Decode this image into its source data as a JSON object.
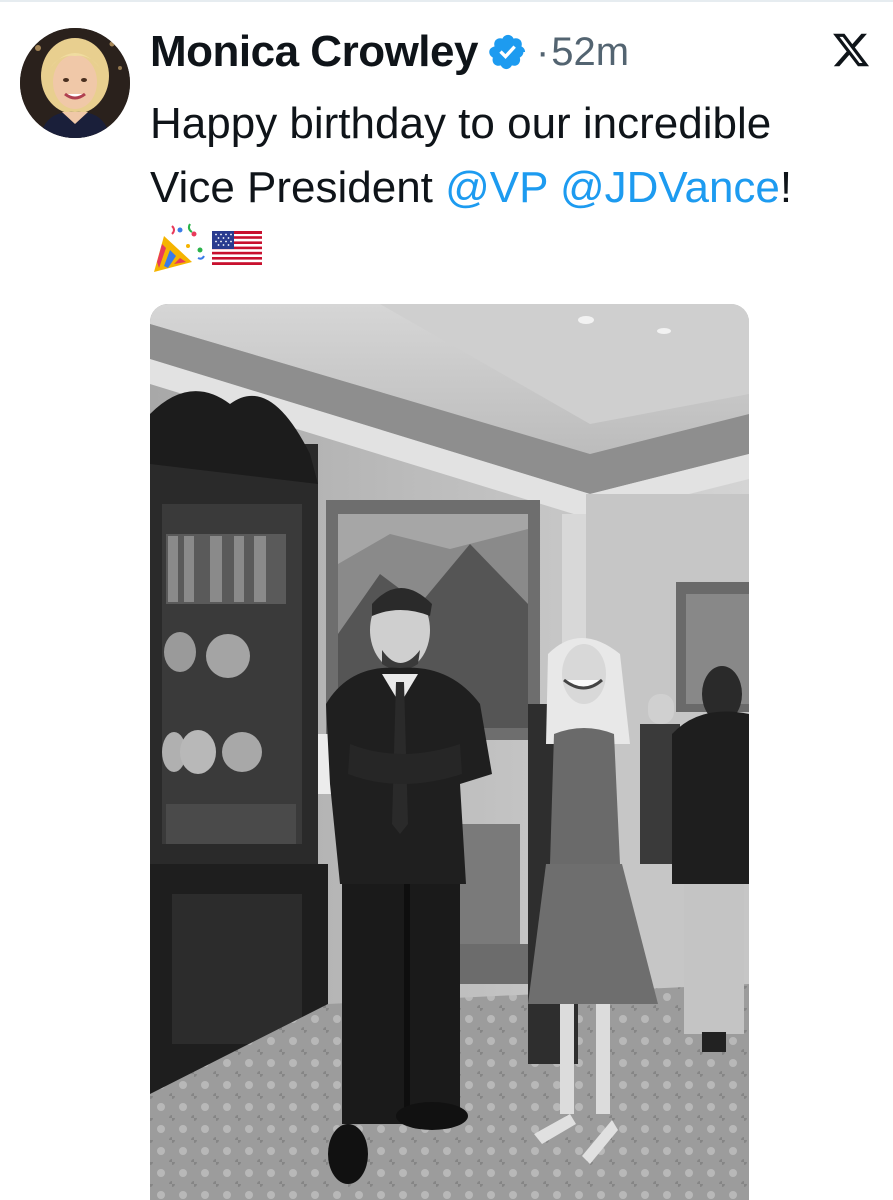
{
  "author": {
    "display_name": "Monica Crowley",
    "verified_icon": "verified-badge-icon",
    "avatar": "profile-avatar"
  },
  "meta": {
    "separator": "·",
    "time_ago": "52m"
  },
  "platform_icon": "x-logo-icon",
  "text": {
    "line1": "Happy birthday to our incredible",
    "line2_prefix": "Vice President ",
    "mention1": "@VP",
    "space": " ",
    "mention2": "@JDVance",
    "line2_suffix": "!",
    "emojis": [
      "party-popper-icon",
      "us-flag-icon"
    ]
  },
  "media": {
    "type": "photo",
    "style": "black-and-white"
  },
  "colors": {
    "mention": "#1d9bf0",
    "verified": "#1d9bf0",
    "text": "#0f1419",
    "muted": "#536471"
  }
}
